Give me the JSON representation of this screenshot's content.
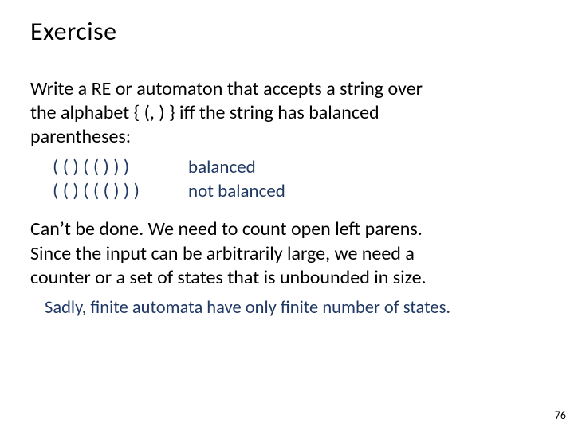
{
  "title": "Exercise",
  "prompt": {
    "line1": "Write a RE or automaton that accepts a string over",
    "line2": "the alphabet { (, ) } iff the string has balanced",
    "line3": "parentheses:"
  },
  "examples": [
    {
      "input": "( ( ) ( ( ) ) )",
      "label": "balanced"
    },
    {
      "input": "( ( ) ( ( ( ) ) )",
      "label": "not balanced"
    }
  ],
  "answer": {
    "l1": "Can’t be done.  We need to count open left parens.",
    "l2": "Since the input can be arbitrarily large, we need a",
    "l3": "counter or a set of states that is unbounded in size."
  },
  "remark": "Sadly, finite automata have only finite number of states.",
  "page_number": "76"
}
